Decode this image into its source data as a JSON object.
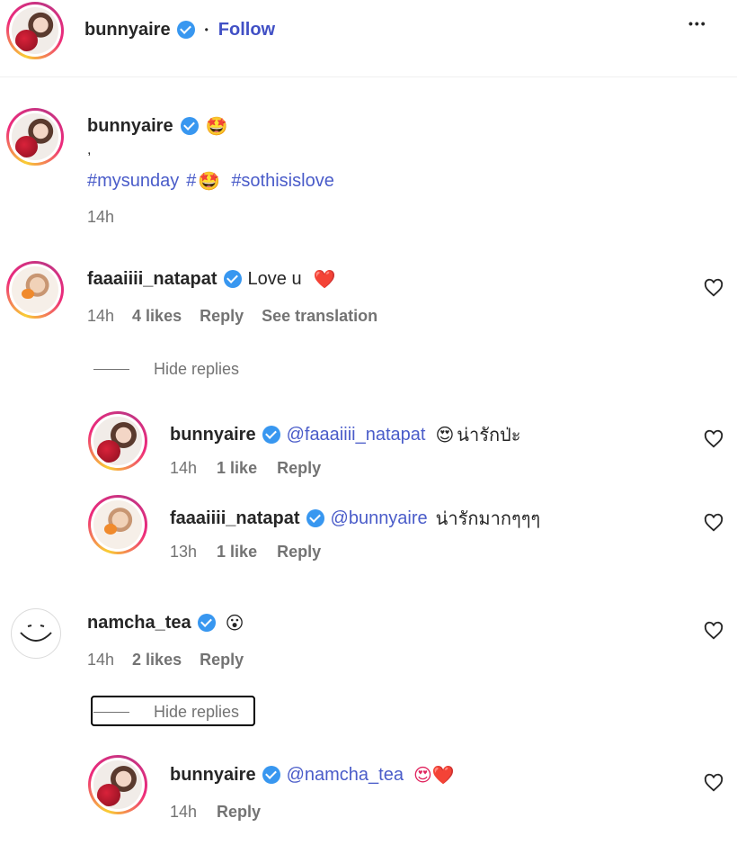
{
  "header": {
    "username": "bunnyaire",
    "dot": "•",
    "follow_label": "Follow",
    "more_label": "•••"
  },
  "caption": {
    "username": "bunnyaire",
    "emoji": "🤩",
    "line2": ",",
    "tag1": "#mysunday",
    "tag2_prefix": "#",
    "tag2_emoji": "🤩",
    "tag3": "#sothisislove",
    "time": "14h"
  },
  "comments": [
    {
      "username": "faaaiiii_natapat",
      "text": "Love u",
      "emoji": "❤️",
      "time": "14h",
      "likes": "4 likes",
      "reply": "Reply",
      "translate": "See translation",
      "hide_replies": "Hide replies",
      "replies": [
        {
          "username": "bunnyaire",
          "mention": "@faaaiiii_natapat",
          "emoji": "😍",
          "text": "น่ารักป่ะ",
          "time": "14h",
          "likes": "1 like",
          "reply": "Reply"
        },
        {
          "username": "faaaiiii_natapat",
          "mention": "@bunnyaire",
          "text": "น่ารักมากๆๆๆ",
          "time": "13h",
          "likes": "1 like",
          "reply": "Reply"
        }
      ]
    },
    {
      "username": "namcha_tea",
      "emoji": "😮",
      "time": "14h",
      "likes": "2 likes",
      "reply": "Reply",
      "hide_replies": "Hide replies",
      "replies": [
        {
          "username": "bunnyaire",
          "mention": "@namcha_tea",
          "emoji": "😍❤️",
          "time": "14h",
          "reply": "Reply"
        }
      ]
    }
  ],
  "icons": {
    "verified": "verified-badge-icon",
    "heart": "heart-outline-icon",
    "more": "more-horizontal-icon"
  },
  "colors": {
    "link": "#4a5cc9",
    "verified": "#3897f0",
    "secondary_text": "#737373",
    "heart_emoji": "#e0245e"
  }
}
